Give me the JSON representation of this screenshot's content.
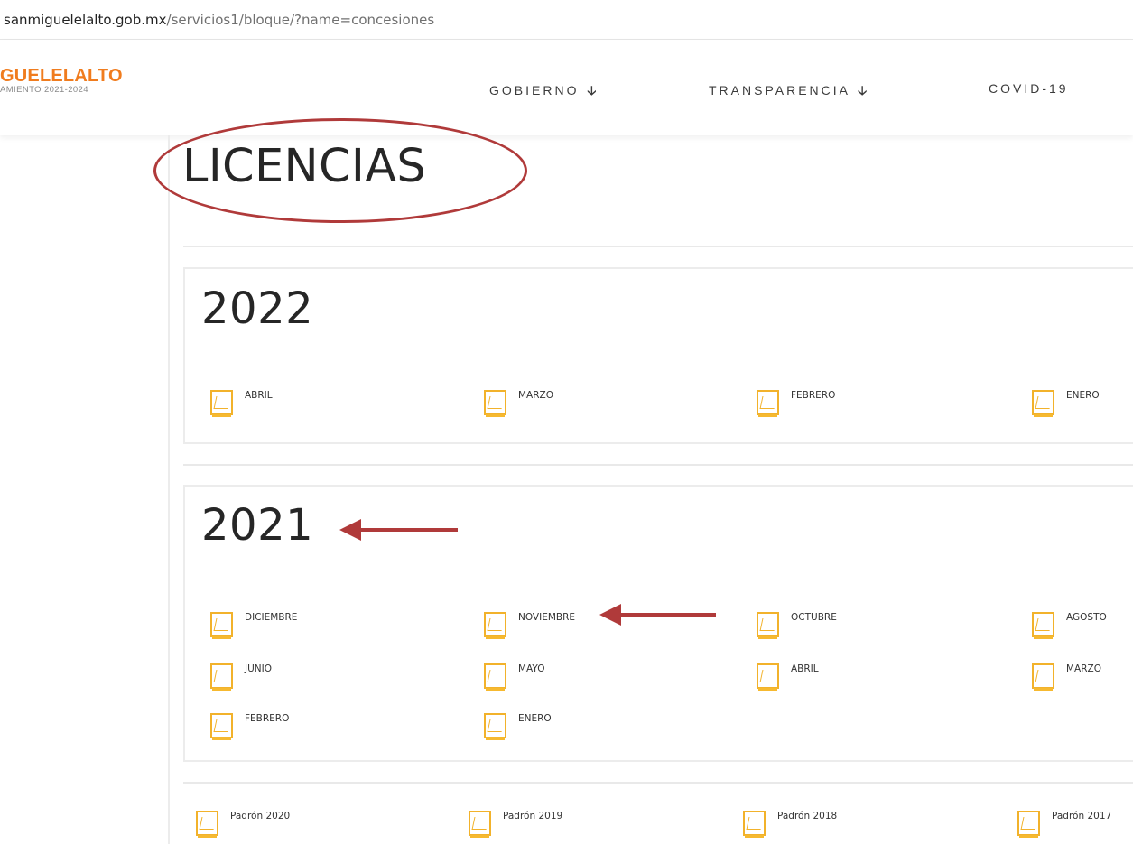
{
  "browser": {
    "url_host": "sanmiguelelalto.gob.mx",
    "url_path": "/servicios1/bloque/?name=concesiones"
  },
  "header": {
    "logo_main": "GUELELALTO",
    "logo_sub": "AMIENTO 2021-2024",
    "nav": [
      {
        "label": "GOBIERNO",
        "arrow": "🡣"
      },
      {
        "label": "TRANSPARENCIA",
        "arrow": "🡣"
      },
      {
        "label": "COVID-19",
        "arrow": ""
      }
    ]
  },
  "page": {
    "title": "LICENCIAS"
  },
  "sections": [
    {
      "year": "2022",
      "files": [
        "ABRIL",
        "MARZO",
        "FEBRERO",
        "ENERO"
      ]
    },
    {
      "year": "2021",
      "files": [
        "DICIEMBRE",
        "NOVIEMBRE",
        "OCTUBRE",
        "AGOSTO",
        "JUNIO",
        "MAYO",
        "ABRIL",
        "MARZO",
        "FEBRERO",
        "ENERO"
      ]
    }
  ],
  "padron": [
    "Padrón 2020",
    "Padrón 2019",
    "Padrón 2018",
    "Padrón 2017"
  ],
  "colors": {
    "logo_orange": "#f07c1e",
    "annotation_red": "#b03a3a",
    "pdf_icon_yellow": "#f2b22b"
  },
  "icons": {
    "file": "pdf-file-icon",
    "nav_dropdown": "arrow-down-icon"
  }
}
